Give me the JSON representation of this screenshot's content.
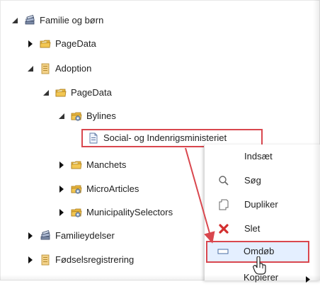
{
  "tree": {
    "items": [
      {
        "label": "Familie og børn",
        "icon": "book-stack-icon",
        "expanded": true
      },
      {
        "label": "PageData",
        "icon": "folder-icon",
        "expanded": false
      },
      {
        "label": "Adoption",
        "icon": "page-icon",
        "expanded": true
      },
      {
        "label": "PageData",
        "icon": "folder-icon",
        "expanded": true
      },
      {
        "label": "Bylines",
        "icon": "gear-folder-icon",
        "expanded": true
      },
      {
        "label": "Social- og Indenrigsministeriet",
        "icon": "document-icon",
        "selected": true
      },
      {
        "label": "Manchets",
        "icon": "folder-icon",
        "expanded": false
      },
      {
        "label": "MicroArticles",
        "icon": "gear-folder-icon",
        "expanded": false
      },
      {
        "label": "MunicipalitySelectors",
        "icon": "gear-folder-icon",
        "expanded": false
      },
      {
        "label": "Familieydelser",
        "icon": "book-stack-icon",
        "expanded": false
      },
      {
        "label": "Fødselsregistrering",
        "icon": "page-icon",
        "expanded": false
      }
    ]
  },
  "context_menu": {
    "items": [
      {
        "label": "Indsæt",
        "icon": "paste-icon"
      },
      {
        "label": "Søg",
        "icon": "search-icon"
      },
      {
        "label": "Dupliker",
        "icon": "duplicate-icon"
      },
      {
        "label": "Slet",
        "icon": "delete-icon"
      },
      {
        "label": "Omdøb",
        "icon": "rename-icon",
        "highlighted": true
      },
      {
        "label": "Kopierer",
        "icon": "copy-icon",
        "has_submenu": true
      }
    ]
  },
  "colors": {
    "highlight_border": "#d9474e",
    "highlight_fill": "#e4efff",
    "folder": "#e8b640",
    "delete": "#d32f2f"
  }
}
